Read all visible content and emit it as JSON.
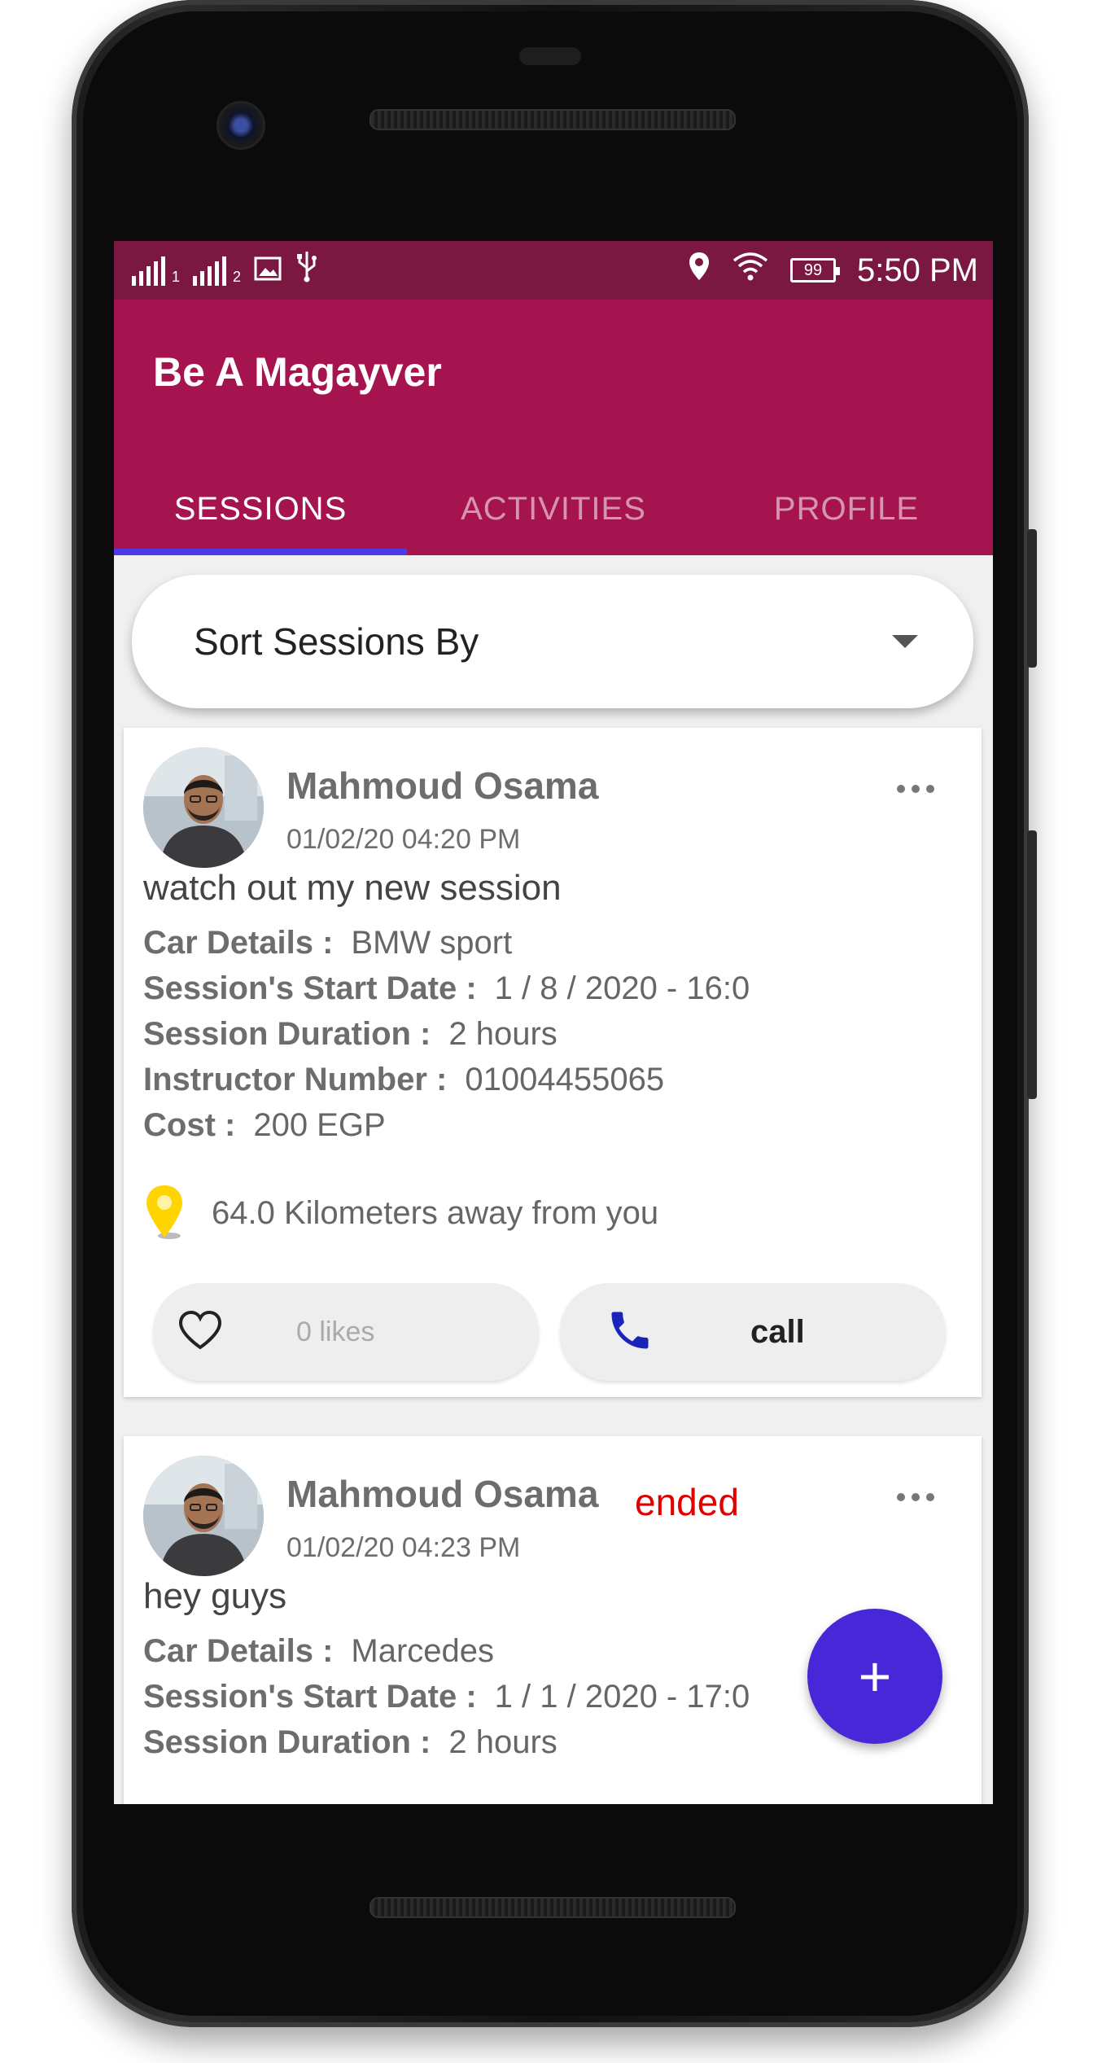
{
  "status_bar": {
    "sim1": "1",
    "sim2": "2",
    "battery": "99",
    "time": "5:50 PM"
  },
  "app": {
    "title": "Be A Magayver",
    "tabs": [
      "SESSIONS",
      "ACTIVITIES",
      "PROFILE"
    ],
    "active_tab": "SESSIONS",
    "accent_color": "#a5144f",
    "indicator_color": "#4b3ae6"
  },
  "sort": {
    "label": "Sort Sessions By"
  },
  "sessions": [
    {
      "author": "Mahmoud Osama",
      "timestamp": "01/02/20 04:20 PM",
      "status": "",
      "text": "watch out my new session",
      "fields": [
        {
          "key": "Car Details :",
          "value": "BMW sport"
        },
        {
          "key": "Session's Start Date :",
          "value": "1 / 8 / 2020 - 16:0"
        },
        {
          "key": "Session Duration :",
          "value": "2 hours"
        },
        {
          "key": "Instructor Number :",
          "value": "01004455065"
        },
        {
          "key": "Cost :",
          "value": "200 EGP"
        }
      ],
      "distance": "64.0 Kilometers away from you",
      "likes": "0 likes",
      "call_label": "call"
    },
    {
      "author": "Mahmoud Osama",
      "timestamp": "01/02/20 04:23 PM",
      "status": "ended",
      "text": "hey guys",
      "fields": [
        {
          "key": "Car Details :",
          "value": "Marcedes"
        },
        {
          "key": "Session's Start Date :",
          "value": "1 / 1 / 2020 - 17:0"
        },
        {
          "key": "Session Duration :",
          "value": "2 hours"
        }
      ]
    }
  ],
  "fab": {
    "label": "+",
    "color": "#4727d8"
  },
  "icons": [
    "signal-icon",
    "image-icon",
    "usb-icon",
    "location-icon",
    "wifi-icon",
    "battery-icon",
    "caret-down-icon",
    "more-icon",
    "pin-icon",
    "heart-icon",
    "phone-icon",
    "plus-icon"
  ]
}
